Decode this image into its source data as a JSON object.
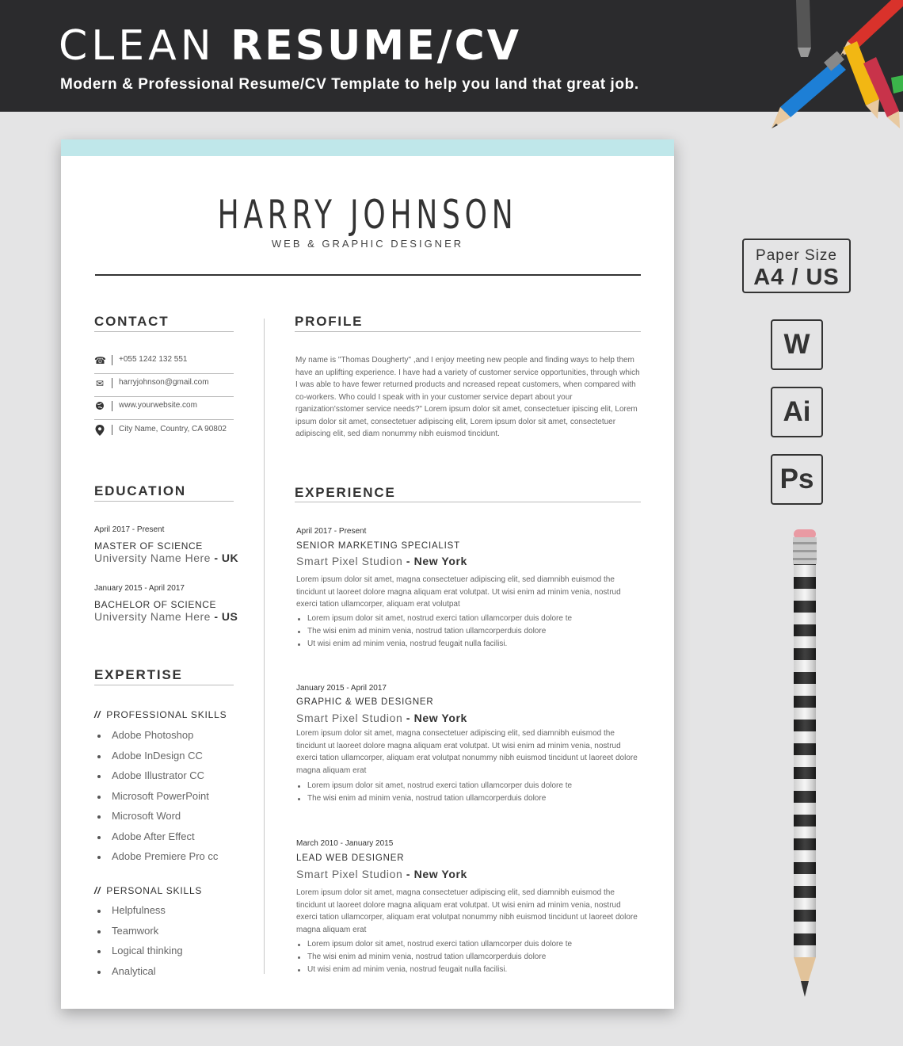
{
  "banner": {
    "title_light": "CLEAN",
    "title_bold": "RESUME/CV",
    "subtitle": "Modern & Professional Resume/CV Template to help you land that great job."
  },
  "resume": {
    "name": "HARRY JOHNSON",
    "role": "WEB & GRAPHIC DESIGNER",
    "contact": {
      "title": "CONTACT",
      "items": [
        {
          "icon": "phone-icon",
          "text": "+055 1242 132 551"
        },
        {
          "icon": "mail-icon",
          "text": "harryjohnson@gmail.com"
        },
        {
          "icon": "globe-icon",
          "text": "www.yourwebsite.com"
        },
        {
          "icon": "location-icon",
          "text": "City Name, Country, CA 90802"
        }
      ]
    },
    "education": {
      "title": "EDUCATION",
      "items": [
        {
          "date": "April 2017 - Present",
          "degree": "MASTER OF SCIENCE",
          "school": "University Name Here",
          "sep": " - ",
          "country": "UK"
        },
        {
          "date": "January 2015 - April 2017",
          "degree": "BACHELOR OF SCIENCE",
          "school": "University Name Here",
          "sep": " - ",
          "country": "US"
        }
      ]
    },
    "expertise": {
      "title": "EXPERTISE",
      "marker": "//",
      "professional_title": "PROFESSIONAL SKILLS",
      "professional": [
        "Adobe Photoshop",
        "Adobe InDesign CC",
        "Adobe Illustrator CC",
        "Microsoft PowerPoint",
        "Microsoft Word",
        "Adobe After Effect",
        "Adobe Premiere Pro cc"
      ],
      "personal_title": "PERSONAL SKILLS",
      "personal": [
        "Helpfulness",
        "Teamwork",
        "Logical thinking",
        "Analytical"
      ]
    },
    "profile": {
      "title": "PROFILE",
      "text": "My name is \"Thomas Dougherty\" ,and I enjoy meeting new people and finding ways to help them have an uplifting experience. I have had a variety of customer service opportunities, through which I was able to have fewer returned products and ncreased repeat customers, when compared with co-workers. Who could I speak with in your customer service depart about your rganization'sstomer service needs?\" Lorem ipsum dolor sit amet, consectetuer ipiscing elit, Lorem ipsum dolor sit amet, consectetuer adipiscing elit, Lorem ipsum dolor sit amet, consectetuer adipiscing elit, sed diam nonummy nibh euismod tincidunt."
    },
    "experience": {
      "title": "EXPERIENCE",
      "jobs": [
        {
          "date": "April 2017 - Present",
          "title": "SENIOR MARKETING SPECIALIST",
          "company": "Smart Pixel Studion",
          "sep": " - ",
          "city": "New York",
          "desc": "Lorem ipsum dolor sit amet, magna consectetuer adipiscing elit, sed diamnibh euismod the tincidunt ut laoreet dolore magna aliquam erat volutpat. Ut wisi enim ad minim venia, nostrud exerci tation ullamcorper, aliquam erat volutpat",
          "bullets": [
            "Lorem ipsum dolor sit amet, nostrud exerci tation ullamcorper duis dolore te",
            "The wisi enim ad minim venia, nostrud  tation ullamcorperduis dolore",
            "Ut wisi enim ad minim venia, nostrud  feugait nulla facilisi."
          ]
        },
        {
          "date": "January 2015 - April 2017",
          "title": "GRAPHIC & WEB DESIGNER",
          "company": "Smart Pixel Studion",
          "sep": " - ",
          "city": "New York",
          "desc": "Lorem ipsum dolor sit amet, magna consectetuer adipiscing elit, sed diamnibh euismod the tincidunt ut laoreet dolore magna aliquam erat volutpat. Ut wisi enim ad minim venia, nostrud exerci tation ullamcorper, aliquam erat volutpat nonummy nibh euismod tincidunt ut laoreet dolore magna aliquam erat",
          "bullets": [
            "Lorem ipsum dolor sit amet, nostrud exerci tation ullamcorper duis dolore te",
            "The wisi enim ad minim venia, nostrud  tation ullamcorperduis dolore"
          ]
        },
        {
          "date": "March 2010 - January 2015",
          "title": "LEAD WEB DESIGNER",
          "company": "Smart Pixel Studion",
          "sep": " - ",
          "city": "New York",
          "desc": "Lorem ipsum dolor sit amet, magna consectetuer adipiscing elit, sed diamnibh euismod the tincidunt ut laoreet dolore magna aliquam erat volutpat. Ut wisi enim ad minim venia, nostrud exerci tation ullamcorper, aliquam erat volutpat nonummy nibh euismod tincidunt ut laoreet dolore magna aliquam erat",
          "bullets": [
            "Lorem ipsum dolor sit amet, nostrud exerci tation ullamcorper duis dolore te",
            "The wisi enim ad minim venia, nostrud  tation ullamcorperduis dolore",
            "Ut wisi enim ad minim venia, nostrud  feugait nulla facilisi."
          ]
        }
      ]
    }
  },
  "sidebar": {
    "paper_label": "Paper Size",
    "paper_value": "A4 / US",
    "apps": [
      "W",
      "Ai",
      "Ps"
    ]
  },
  "colors": {
    "banner_bg": "#2b2b2d",
    "accent_bar": "#bfe7ea",
    "page_bg": "#e4e4e5"
  }
}
